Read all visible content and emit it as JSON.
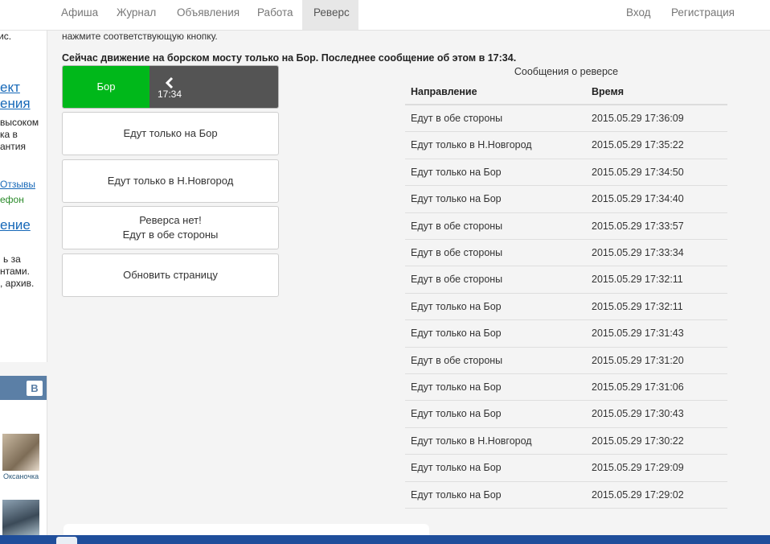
{
  "nav": {
    "left_items": [
      "Афиша",
      "Журнал",
      "Объявления",
      "Работа",
      "Реверс"
    ],
    "active": "Реверс",
    "right_items": [
      "Вход",
      "Регистрация"
    ]
  },
  "sidebar_fragments": {
    "line1": "ис.",
    "big1": "ект",
    "big2": "ения",
    "text1": "высоком",
    "text2": "ка в",
    "text3": "антия",
    "link1": "Отзывы",
    "green1": "ефон",
    "big3": "ение",
    "text4": "ь за",
    "text5": "нтами.",
    "text6": ", архив."
  },
  "vk": {
    "logo": "В",
    "member_name": "Оксаночка"
  },
  "intro_text": "нажмите соответствующую кнопку.",
  "status_text": "Сейчас движение на борском мосту только на Бор. Последнее сообщение об этом в 17:34.",
  "current_state": {
    "direction": "Бор",
    "time": "17:34",
    "color": "#00b81a"
  },
  "buttons": {
    "only_bor": "Едут только на Бор",
    "only_nn": "Едут только в Н.Новгород",
    "no_reverse_line1": "Реверса нет!",
    "no_reverse_line2": "Едут в обе стороны",
    "refresh": "Обновить страницу"
  },
  "messages": {
    "caption": "Сообщения о реверсе",
    "col_direction": "Направление",
    "col_time": "Время",
    "rows": [
      {
        "direction": "Едут в обе стороны",
        "time": "2015.05.29 17:36:09"
      },
      {
        "direction": "Едут только в Н.Новгород",
        "time": "2015.05.29 17:35:22"
      },
      {
        "direction": "Едут только на Бор",
        "time": "2015.05.29 17:34:50"
      },
      {
        "direction": "Едут только на Бор",
        "time": "2015.05.29 17:34:40"
      },
      {
        "direction": "Едут в обе стороны",
        "time": "2015.05.29 17:33:57"
      },
      {
        "direction": "Едут в обе стороны",
        "time": "2015.05.29 17:33:34"
      },
      {
        "direction": "Едут в обе стороны",
        "time": "2015.05.29 17:32:11"
      },
      {
        "direction": "Едут только на Бор",
        "time": "2015.05.29 17:32:11"
      },
      {
        "direction": "Едут только на Бор",
        "time": "2015.05.29 17:31:43"
      },
      {
        "direction": "Едут в обе стороны",
        "time": "2015.05.29 17:31:20"
      },
      {
        "direction": "Едут только на Бор",
        "time": "2015.05.29 17:31:06"
      },
      {
        "direction": "Едут только на Бор",
        "time": "2015.05.29 17:30:43"
      },
      {
        "direction": "Едут только в Н.Новгород",
        "time": "2015.05.29 17:30:22"
      },
      {
        "direction": "Едут только на Бор",
        "time": "2015.05.29 17:29:09"
      },
      {
        "direction": "Едут только на Бор",
        "time": "2015.05.29 17:29:02"
      }
    ]
  }
}
